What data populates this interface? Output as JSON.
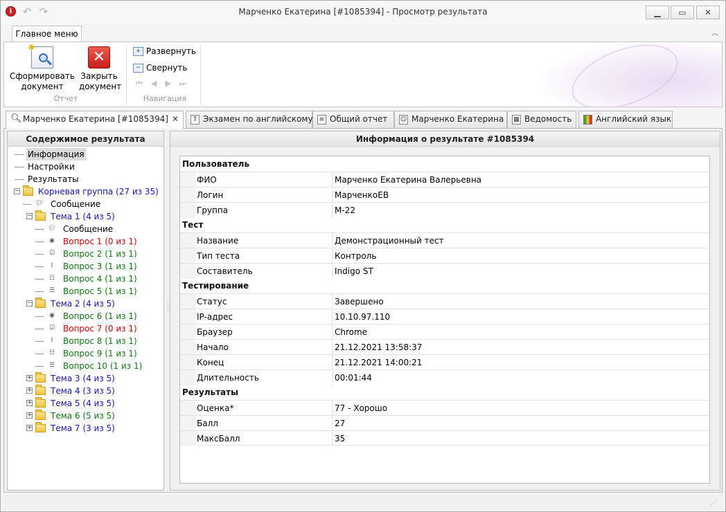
{
  "window": {
    "title": "Марченко Екатерина [#1085394] - Просмотр результата",
    "app_icon": "info-icon",
    "controls": [
      "minimize",
      "maximize",
      "close"
    ]
  },
  "ribbon": {
    "tab_label": "Главное меню",
    "groups": {
      "report": {
        "label": "Отчет",
        "generate_label": "Сформировать документ",
        "close_label": "Закрыть документ"
      },
      "navigation": {
        "label": "Навигация",
        "expand_label": "Развернуть",
        "collapse_label": "Свернуть"
      }
    }
  },
  "tabs": [
    {
      "label": "Марченко Екатерина [#1085394]",
      "icon": "search-icon",
      "active": true
    },
    {
      "label": "Экзамен по английскому",
      "icon": "text-icon"
    },
    {
      "label": "Общий отчет",
      "icon": "document-icon"
    },
    {
      "label": "Марченко Екатерина",
      "icon": "user-icon"
    },
    {
      "label": "Ведомость",
      "icon": "sheet-icon"
    },
    {
      "label": "Английский язык",
      "icon": "chart-icon"
    }
  ],
  "left_panel": {
    "title": "Содержимое результата",
    "tree": [
      {
        "label": "Информация",
        "color": "#000000",
        "icon": "none"
      },
      {
        "label": "Настройки",
        "color": "#000000",
        "icon": "none"
      },
      {
        "label": "Результаты",
        "color": "#000000",
        "icon": "none"
      },
      {
        "label": "Корневая группа (27 из 35)",
        "color": "#1414c8",
        "icon": "folder-icon"
      },
      {
        "label": "Сообщение",
        "color": "#000000",
        "icon": "message-icon"
      },
      {
        "label": "Тема 1 (4 из 5)",
        "color": "#1414c8",
        "icon": "folder-icon"
      },
      {
        "label": "Сообщение",
        "color": "#000000",
        "icon": "message-icon"
      },
      {
        "label": "Вопрос 1 (0 из 1)",
        "color": "#d40000",
        "icon": "radio-icon"
      },
      {
        "label": "Вопрос 2 (1 из 1)",
        "color": "#0f7a0f",
        "icon": "checkbox-icon"
      },
      {
        "label": "Вопрос 3 (1 из 1)",
        "color": "#0f7a0f",
        "icon": "text-input-icon"
      },
      {
        "label": "Вопрос 4 (1 из 1)",
        "color": "#0f7a0f",
        "icon": "matching-icon"
      },
      {
        "label": "Вопрос 5 (1 из 1)",
        "color": "#0f7a0f",
        "icon": "ordering-icon"
      },
      {
        "label": "Тема 2 (4 из 5)",
        "color": "#1414c8",
        "icon": "folder-icon"
      },
      {
        "label": "Вопрос 6 (1 из 1)",
        "color": "#0f7a0f",
        "icon": "radio-icon"
      },
      {
        "label": "Вопрос 7 (0 из 1)",
        "color": "#d40000",
        "icon": "checkbox-icon"
      },
      {
        "label": "Вопрос 8 (1 из 1)",
        "color": "#0f7a0f",
        "icon": "text-input-icon"
      },
      {
        "label": "Вопрос 9 (1 из 1)",
        "color": "#0f7a0f",
        "icon": "matching-icon"
      },
      {
        "label": "Вопрос 10 (1 из 1)",
        "color": "#0f7a0f",
        "icon": "ordering-icon"
      },
      {
        "label": "Тема 3 (4 из 5)",
        "color": "#1414c8",
        "icon": "folder-icon"
      },
      {
        "label": "Тема 4 (3 из 5)",
        "color": "#1414c8",
        "icon": "folder-icon"
      },
      {
        "label": "Тема 5 (4 из 5)",
        "color": "#1414c8",
        "icon": "folder-icon"
      },
      {
        "label": "Тема 6 (5 из 5)",
        "color": "#0f7a0f",
        "icon": "folder-icon"
      },
      {
        "label": "Тема 7 (3 из 5)",
        "color": "#1414c8",
        "icon": "folder-icon"
      }
    ]
  },
  "info": {
    "title": "Информация о результате #1085394",
    "sections": [
      {
        "title": "Пользователь",
        "rows": [
          {
            "key": "ФИО",
            "value": "Марченко Екатерина Валерьевна"
          },
          {
            "key": "Логин",
            "value": "МарченкоЕВ"
          },
          {
            "key": "Группа",
            "value": "М-22"
          }
        ]
      },
      {
        "title": "Тест",
        "rows": [
          {
            "key": "Название",
            "value": "Демонстрационный тест"
          },
          {
            "key": "Тип теста",
            "value": "Контроль"
          },
          {
            "key": "Составитель",
            "value": "Indigo ST"
          }
        ]
      },
      {
        "title": "Тестирование",
        "rows": [
          {
            "key": "Статус",
            "value": "Завершено"
          },
          {
            "key": "IP-адрес",
            "value": "10.10.97.110"
          },
          {
            "key": "Браузер",
            "value": "Chrome"
          },
          {
            "key": "Начало",
            "value": "21.12.2021 13:58:37"
          },
          {
            "key": "Конец",
            "value": "21.12.2021 14:00:21"
          },
          {
            "key": "Длительность",
            "value": "00:01:44"
          }
        ]
      },
      {
        "title": "Результаты",
        "rows": [
          {
            "key": "Оценка*",
            "value": "77 - Хорошо"
          },
          {
            "key": "Балл",
            "value": "27"
          },
          {
            "key": "МаксБалл",
            "value": "35"
          }
        ]
      }
    ]
  }
}
